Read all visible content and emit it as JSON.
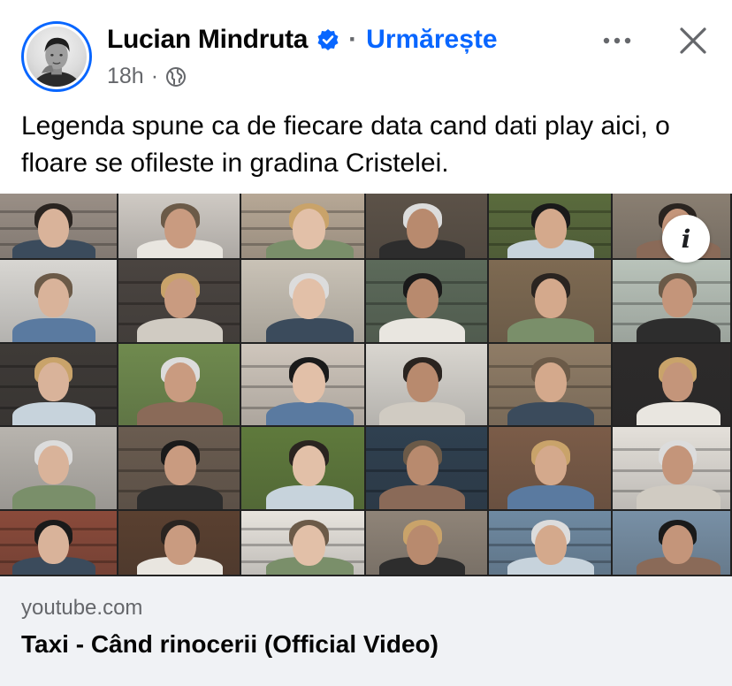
{
  "post": {
    "author": "Lucian Mindruta",
    "separator": "·",
    "follow_label": "Urmărește",
    "time": "18h",
    "meta_separator": "·",
    "text": "Legenda spune ca de fiecare data cand dati play aici, o floare se ofileste in gradina Cristelei."
  },
  "icons": {
    "verified": "verified-badge-icon",
    "audience": "globe-icon",
    "more": "more-options-icon",
    "close": "close-icon",
    "info": "info-icon"
  },
  "colors": {
    "accent": "#0866ff",
    "secondary_text": "#65676b",
    "footer_bg": "#f0f2f5"
  },
  "media": {
    "info_label": "i"
  },
  "link_preview": {
    "domain": "youtube.com",
    "title": "Taxi - Când rinocerii (Official Video)"
  }
}
